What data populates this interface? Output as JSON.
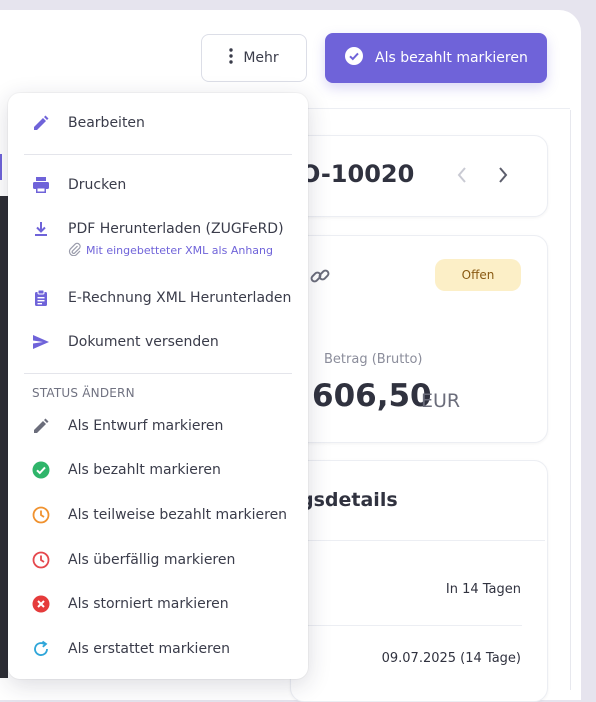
{
  "header": {
    "more_label": "Mehr",
    "mark_paid_label": "Als bezahlt markieren"
  },
  "invoice": {
    "number_partial": "O-10020",
    "status_badge": "Offen",
    "amount_label": "Betrag (Brutto)",
    "amount_value": "606,50",
    "amount_currency": "EUR"
  },
  "details": {
    "title_partial": "gsdetails",
    "row1_value": "In 14 Tagen",
    "row2_value": "09.07.2025 (14 Tage)"
  },
  "menu": {
    "items": [
      {
        "label": "Bearbeiten",
        "icon": "pencil-icon"
      },
      {
        "label": "Drucken",
        "icon": "printer-icon"
      },
      {
        "label": "PDF Herunterladen (ZUGFeRD)",
        "sublabel": "Mit eingebetteter XML als Anhang",
        "icon": "download-icon"
      },
      {
        "label": "E-Rechnung XML Herunterladen",
        "icon": "clipboard-icon"
      },
      {
        "label": "Dokument versenden",
        "icon": "send-icon"
      }
    ],
    "status_section_title": "STATUS ÄNDERN",
    "status_items": [
      {
        "label": "Als Entwurf markieren",
        "icon": "pencil-icon",
        "color": "#6b6d7b"
      },
      {
        "label": "Als bezahlt markieren",
        "icon": "check-circle-icon",
        "color": "#2fb56a"
      },
      {
        "label": "Als teilweise bezahlt markieren",
        "icon": "clock-icon",
        "color": "#f0922f"
      },
      {
        "label": "Als überfällig markieren",
        "icon": "clock-icon",
        "color": "#e5484d"
      },
      {
        "label": "Als storniert markieren",
        "icon": "x-circle-icon",
        "color": "#e53b3b"
      },
      {
        "label": "Als erstattet markieren",
        "icon": "refresh-icon",
        "color": "#2fa6d9"
      }
    ]
  },
  "colors": {
    "accent": "#6f63d9",
    "badge_bg": "#fcefc7",
    "badge_text": "#8a5a12"
  }
}
